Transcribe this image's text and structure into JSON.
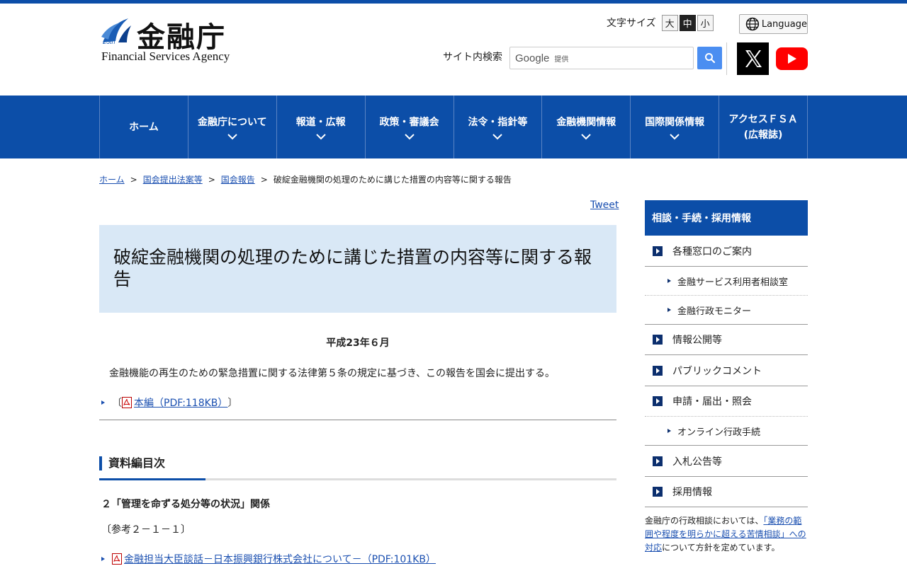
{
  "header": {
    "logo_jp": "金融庁",
    "logo_en": "Financial Services Agency",
    "fontsize_label": "文字サイズ",
    "fontsize_options": [
      "大",
      "中",
      "小"
    ],
    "fontsize_selected": "中",
    "language_label": "Language",
    "search_label": "サイト内検索",
    "search_brand": "Google",
    "search_brand_suffix": "提供"
  },
  "nav": {
    "items": [
      {
        "label": "ホーム"
      },
      {
        "label": "金融庁について"
      },
      {
        "label": "報道・広報"
      },
      {
        "label": "政策・審議会"
      },
      {
        "label": "法令・指針等"
      },
      {
        "label": "金融機関情報"
      },
      {
        "label": "国際関係情報"
      },
      {
        "label": "アクセスＦＳＡ",
        "label2": "(広報誌)"
      }
    ]
  },
  "breadcrumb": {
    "items": [
      "ホーム",
      "国会提出法案等",
      "国会報告"
    ],
    "current": "破綻金融機関の処理のために講じた措置の内容等に関する報告",
    "separator": ">"
  },
  "main": {
    "tweet": "Tweet",
    "title": "破綻金融機関の処理のために講じた措置の内容等に関する報告",
    "date": "平成23年６月",
    "lead": "金融機能の再生のための緊急措置に関する法律第５条の規定に基づき、この報告を国会に提出する。",
    "pdf_main": {
      "open": "〔",
      "label": "本編（PDF:118KB）",
      "close": "〕"
    },
    "section_title": "資料編目次",
    "subhead": "２「管理を命ずる処分等の状況」関係",
    "ref": "〔参考２－１－１〕",
    "pdf_ref": "金融担当大臣談話－日本振興銀行株式会社について－（PDF:101KB）"
  },
  "sidebar": {
    "heading": "相談・手続・採用情報",
    "items": [
      {
        "label": "各種窓口のご案内",
        "level": "main"
      },
      {
        "label": "金融サービス利用者相談室",
        "level": "sub"
      },
      {
        "label": "金融行政モニター",
        "level": "sub"
      },
      {
        "label": "情報公開等",
        "level": "main"
      },
      {
        "label": "パブリックコメント",
        "level": "main"
      },
      {
        "label": "申請・届出・照会",
        "level": "main"
      },
      {
        "label": "オンライン行政手続",
        "level": "sub"
      },
      {
        "label": "入札公告等",
        "level": "main"
      },
      {
        "label": "採用情報",
        "level": "main"
      }
    ],
    "note_before": "金融庁の行政相談においては、",
    "note_link": "「業務の範囲や程度を明らかに超える苦情相談」への対応",
    "note_after": "について方針を定めています。"
  },
  "colors": {
    "brand_blue": "#0c4ea8",
    "title_bg": "#d9e8f6",
    "link": "#1a4fb0"
  }
}
